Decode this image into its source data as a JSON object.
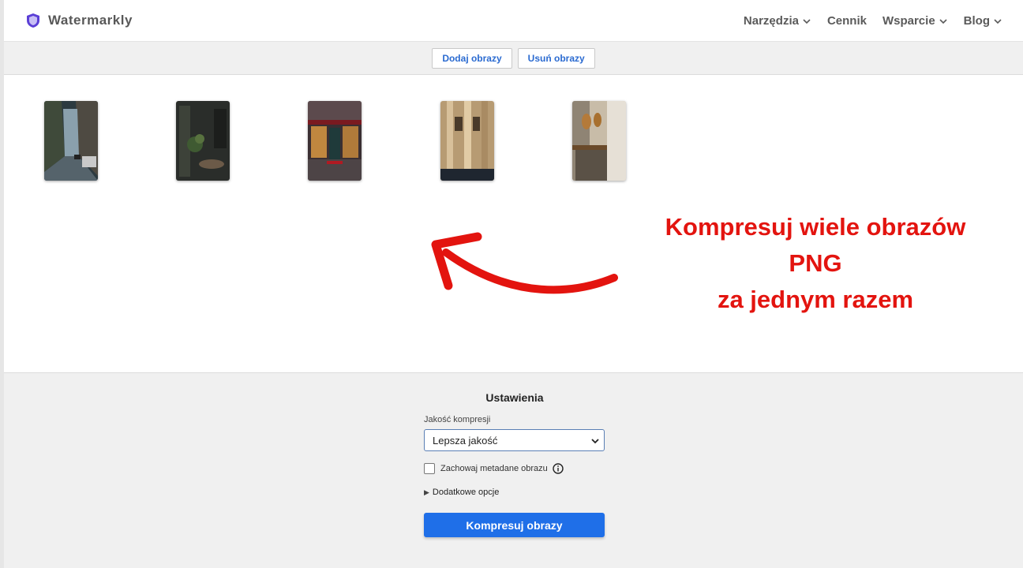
{
  "header": {
    "brand": "Watermarkly",
    "nav": [
      {
        "label": "Narzędzia",
        "dropdown": true
      },
      {
        "label": "Cennik",
        "dropdown": false
      },
      {
        "label": "Wsparcie",
        "dropdown": true
      },
      {
        "label": "Blog",
        "dropdown": true
      }
    ]
  },
  "toolbar": {
    "add_label": "Dodaj obrazy",
    "remove_label": "Usuń obrazy"
  },
  "promo": {
    "line1": "Kompresuj wiele obrazów",
    "line2": "PNG",
    "line3": "za jednym razem"
  },
  "settings": {
    "title": "Ustawienia",
    "quality_label": "Jakość kompresji",
    "quality_value": "Lepsza jakość",
    "metadata_label": "Zachowaj metadane obrazu",
    "more_options": "Dodatkowe opcje",
    "compress_button": "Kompresuj obrazy"
  },
  "colors": {
    "accent": "#1f6fe8",
    "promo_red": "#e3140f",
    "logo": "#5b3fd6"
  }
}
